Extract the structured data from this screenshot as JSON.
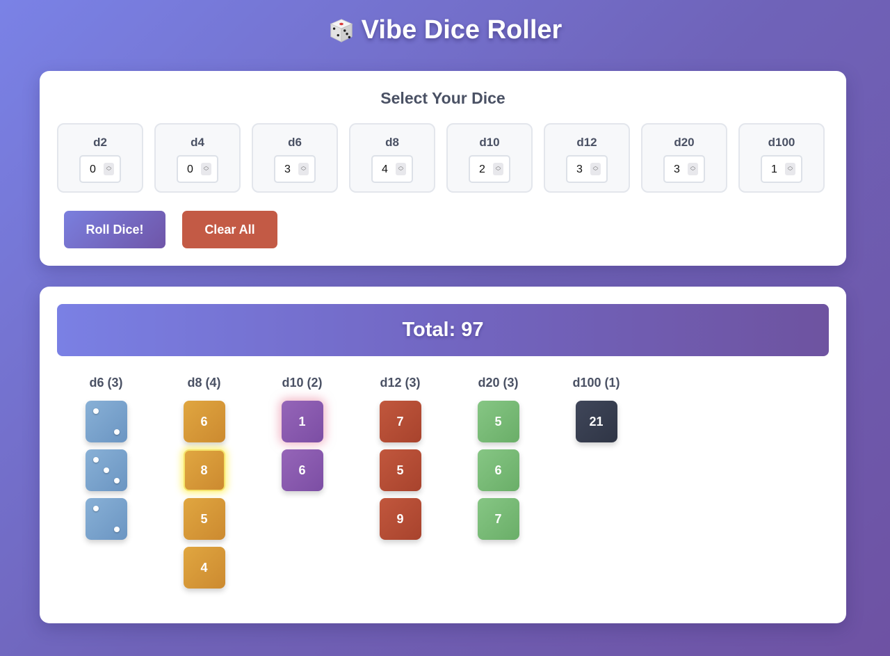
{
  "app": {
    "title": "Vibe Dice Roller",
    "title_icon": "die-icon"
  },
  "selector": {
    "heading": "Select Your Dice",
    "dice": [
      {
        "label": "d2",
        "count": "0"
      },
      {
        "label": "d4",
        "count": "0"
      },
      {
        "label": "d6",
        "count": "3"
      },
      {
        "label": "d8",
        "count": "4"
      },
      {
        "label": "d10",
        "count": "2"
      },
      {
        "label": "d12",
        "count": "3"
      },
      {
        "label": "d20",
        "count": "3"
      },
      {
        "label": "d100",
        "count": "1"
      }
    ],
    "roll_label": "Roll Dice!",
    "clear_label": "Clear All"
  },
  "results": {
    "total_label": "Total: 97",
    "groups": [
      {
        "label": "d6 (3)",
        "type": "d6",
        "pips": true,
        "values": [
          2,
          3,
          2
        ]
      },
      {
        "label": "d8 (4)",
        "type": "d8",
        "values": [
          6,
          8,
          5,
          4
        ],
        "max_index": 1
      },
      {
        "label": "d10 (2)",
        "type": "d10",
        "values": [
          1,
          6
        ],
        "min_index": 0
      },
      {
        "label": "d12 (3)",
        "type": "d12",
        "values": [
          7,
          5,
          9
        ]
      },
      {
        "label": "d20 (3)",
        "type": "d20",
        "values": [
          5,
          6,
          7
        ]
      },
      {
        "label": "d100 (1)",
        "type": "d100",
        "values": [
          21
        ]
      }
    ]
  },
  "colors": {
    "d6": "#7aa3cd",
    "d8": "#d69a38",
    "d10": "#8a5aaf",
    "d12": "#b54d35",
    "d20": "#78ba76",
    "d100": "#373d4f",
    "roll_button": "#7469c4",
    "clear_button": "#c35a45"
  }
}
